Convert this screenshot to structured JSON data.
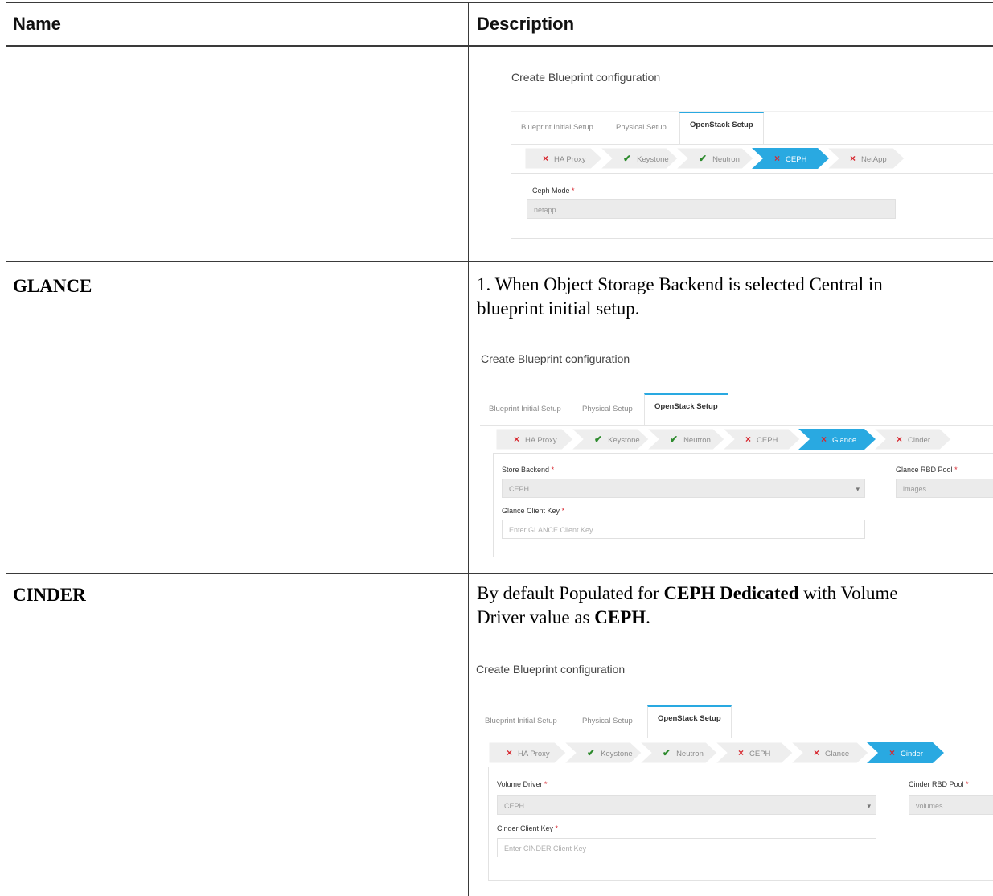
{
  "table": {
    "headers": {
      "name": "Name",
      "description": "Description"
    },
    "rows": [
      {
        "name": "",
        "screenshot": {
          "title": "Create Blueprint configuration",
          "tabs": [
            "Blueprint Initial Setup",
            "Physical Setup",
            "OpenStack Setup"
          ],
          "active_tab": "OpenStack Setup",
          "steps": [
            {
              "label": "HA Proxy",
              "status": "error",
              "active": false
            },
            {
              "label": "Keystone",
              "status": "ok",
              "active": false
            },
            {
              "label": "Neutron",
              "status": "ok",
              "active": false
            },
            {
              "label": "CEPH",
              "status": "error",
              "active": true
            },
            {
              "label": "NetApp",
              "status": "error",
              "active": false
            }
          ],
          "fields": {
            "ceph_mode_label": "Ceph Mode",
            "ceph_mode_value": "netapp"
          }
        }
      },
      {
        "name": "GLANCE",
        "description_line1": "1. When Object Storage Backend is selected Central in",
        "description_line2": "blueprint initial setup.",
        "screenshot": {
          "title": "Create Blueprint configuration",
          "tabs": [
            "Blueprint Initial Setup",
            "Physical Setup",
            "OpenStack Setup"
          ],
          "active_tab": "OpenStack Setup",
          "steps": [
            {
              "label": "HA Proxy",
              "status": "error",
              "active": false
            },
            {
              "label": "Keystone",
              "status": "ok",
              "active": false
            },
            {
              "label": "Neutron",
              "status": "ok",
              "active": false
            },
            {
              "label": "CEPH",
              "status": "error",
              "active": false
            },
            {
              "label": "Glance",
              "status": "error",
              "active": true
            },
            {
              "label": "Cinder",
              "status": "error",
              "active": false
            }
          ],
          "fields": {
            "store_backend_label": "Store Backend",
            "store_backend_value": "CEPH",
            "pool_label": "Glance RBD Pool",
            "pool_value": "images",
            "client_key_label": "Glance Client Key",
            "client_key_placeholder": "Enter GLANCE Client Key"
          }
        }
      },
      {
        "name": "CINDER",
        "description_part1": "By default Populated for ",
        "description_bold1": "CEPH Dedicated",
        "description_part2": " with Volume",
        "description_part3": "Driver value as ",
        "description_bold2": "CEPH",
        "description_part4": ".",
        "screenshot": {
          "title": "Create Blueprint configuration",
          "tabs": [
            "Blueprint Initial Setup",
            "Physical Setup",
            "OpenStack Setup"
          ],
          "active_tab": "OpenStack Setup",
          "steps": [
            {
              "label": "HA Proxy",
              "status": "error",
              "active": false
            },
            {
              "label": "Keystone",
              "status": "ok",
              "active": false
            },
            {
              "label": "Neutron",
              "status": "ok",
              "active": false
            },
            {
              "label": "CEPH",
              "status": "error",
              "active": false
            },
            {
              "label": "Glance",
              "status": "error",
              "active": false
            },
            {
              "label": "Cinder",
              "status": "error",
              "active": true
            }
          ],
          "fields": {
            "volume_driver_label": "Volume Driver",
            "volume_driver_value": "CEPH",
            "pool_label": "Cinder RBD Pool",
            "pool_value": "volumes",
            "client_key_label": "Cinder Client Key",
            "client_key_placeholder": "Enter CINDER Client Key"
          }
        }
      }
    ]
  },
  "colors": {
    "active_step": "#29a9e1",
    "inactive_step": "#eeeeee",
    "error_icon": "#d7262e",
    "ok_icon": "#2e8b2e"
  },
  "icons": {
    "error": "×",
    "ok": "✔"
  }
}
